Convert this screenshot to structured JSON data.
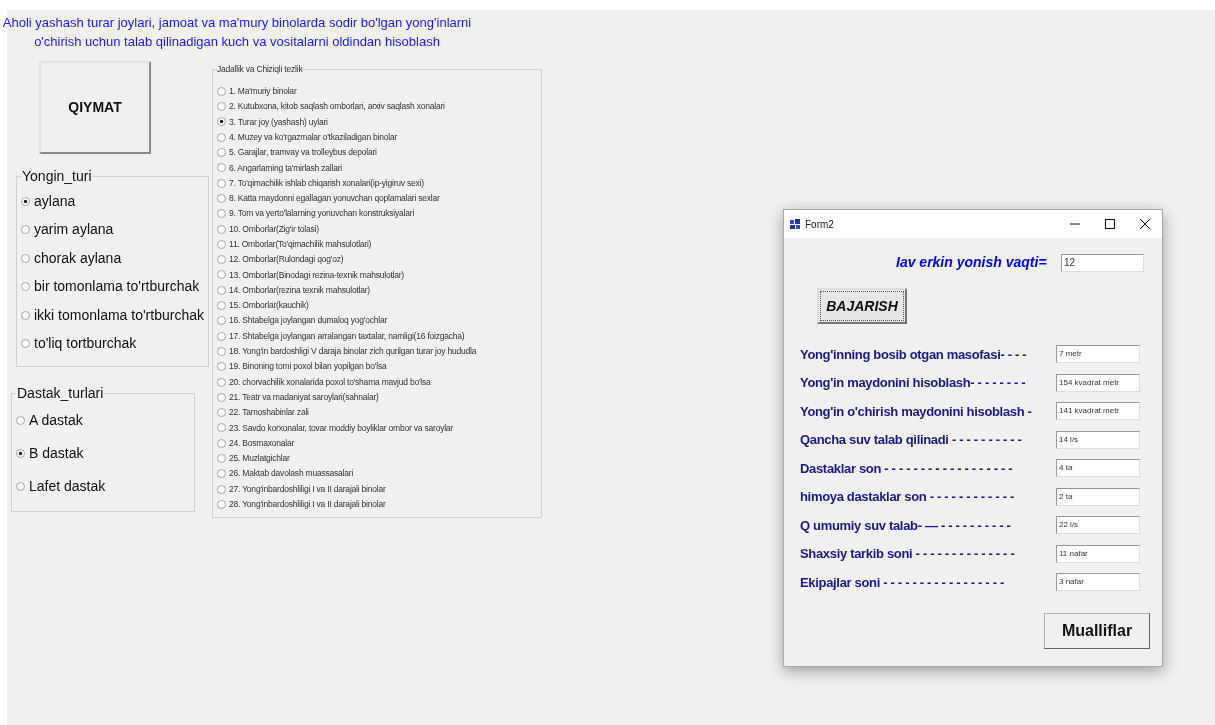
{
  "header": {
    "lines": [
      "Aholi yashash turar joylari, jamoat va ma'mury binolarda sodir bo'lgan yong'inlarni",
      "o'chirish uchun talab qilinadigan kuch va vositalarni oldindan hisoblash"
    ]
  },
  "qiymat_button": "QIYMAT",
  "yongin_turi": {
    "title": "Yongin_turi",
    "options": [
      {
        "label": "aylana",
        "selected": true
      },
      {
        "label": "yarim aylana",
        "selected": false
      },
      {
        "label": "chorak aylana",
        "selected": false
      },
      {
        "label": "bir tomonlama to'rtburchak",
        "selected": false
      },
      {
        "label": "ikki tomonlama to'rtburchak",
        "selected": false
      },
      {
        "label": "to'liq tortburchak",
        "selected": false
      }
    ]
  },
  "dastak_turlari": {
    "title": "Dastak_turlari",
    "options": [
      {
        "label": "A dastak",
        "selected": false
      },
      {
        "label": "B dastak",
        "selected": true
      },
      {
        "label": "Lafet dastak",
        "selected": false
      }
    ]
  },
  "jadallik": {
    "title": "Jadallik va Chiziqli tezlik",
    "options": [
      {
        "label": "1. Ma'muriy binolar",
        "selected": false
      },
      {
        "label": "2. Kutubxona, kitob saqlash omborlari, arxiv saqlash xonalari",
        "selected": false
      },
      {
        "label": "3. Turar joy (yashash) uylari",
        "selected": true
      },
      {
        "label": "4. Muzey va ko'rgazmalar o'tkaziladigan binolar",
        "selected": false
      },
      {
        "label": "5. Garajlar, tramvay va trolleybus depolari",
        "selected": false
      },
      {
        "label": "6. Angarlarning ta'mirlash zallari",
        "selected": false
      },
      {
        "label": "7. To'qimachilik ishlab chiqarish xonalari(ip-yigiruv sexi)",
        "selected": false
      },
      {
        "label": "8. Katta maydonni egallagan yonuvchan qoplamalari sexlar",
        "selected": false
      },
      {
        "label": "9. Tom va yerto'lalarning yonuvchan konstruksiyalari",
        "selected": false
      },
      {
        "label": "10. Omborlar(Zig'ir tolasi)",
        "selected": false
      },
      {
        "label": "11. Omborlar(To'qimachilik mahsulotlari)",
        "selected": false
      },
      {
        "label": "12. Omborlar(Rulondagi qog'oz)",
        "selected": false
      },
      {
        "label": "13. Omborlar(Binodagi rezina-texnik mahsulotlar)",
        "selected": false
      },
      {
        "label": "14. Omborlar(rezina texnik mahsulotlar)",
        "selected": false
      },
      {
        "label": "15. Omborlar(kauchik)",
        "selected": false
      },
      {
        "label": "16. Shtabelga joylangan dumaloq yog'ochlar",
        "selected": false
      },
      {
        "label": "17. Shtabelga joylangan arralangan taxtalar, namligi(16 foizgacha)",
        "selected": false
      },
      {
        "label": "18. Yong'in bardoshligi V daraja binolar zich qurilgan turar joy hududla",
        "selected": false
      },
      {
        "label": "19. Binoning tomi poxol bilan yopilgan bo'lsa",
        "selected": false
      },
      {
        "label": "20. chorvachilik xonalarida poxol to'shama mavjud bo'lsa",
        "selected": false
      },
      {
        "label": "21. Teatr va madaniyat saroylari(sahnalar)",
        "selected": false
      },
      {
        "label": "22. Tamoshabinlar zali",
        "selected": false
      },
      {
        "label": "23. Savdo korxonalar, tovar moddiy boyliklar ombor va saroylar",
        "selected": false
      },
      {
        "label": "24. Bosmaxonalar",
        "selected": false
      },
      {
        "label": "25. Muzlatgichlar",
        "selected": false
      },
      {
        "label": "26. Maktab davolash muassasalari",
        "selected": false
      },
      {
        "label": "27. Yong'inbardoshliligi I va II darajali binolar",
        "selected": false
      },
      {
        "label": "28. Yong'inbardoshliligi I va II darajali binolar",
        "selected": false
      }
    ]
  },
  "form2": {
    "title": "Form2",
    "time_label": "Iav erkin yonish vaqti=",
    "time_value": "12",
    "run_button": "BAJARISH",
    "results": [
      {
        "label": "Yong'inning bosib otgan masofasi- - - -",
        "value": "7 metr"
      },
      {
        "label": "Yong'in maydonini hisoblash- - - - - - - -",
        "value": "154 kvadrat metr"
      },
      {
        "label": "Yong'in o'chirish maydonini hisoblash -",
        "value": "141 kvadrat metr"
      },
      {
        "label": "Qancha suv talab qilinadi - - - - - - - - - -",
        "value": "14 l/s"
      },
      {
        "label": "Dastaklar son - - - - - - - - - - - - - - - - - -",
        "value": "4 ta"
      },
      {
        "label": "himoya dastaklar son - - - - - - - - -  - - -",
        "value": "2 ta"
      },
      {
        "label": "Q umumiy suv talab- — - - - - - - -  - - -",
        "value": "22 l/s"
      },
      {
        "label": "Shaxsiy tarkib soni - - - - - - - - - - - - - -",
        "value": "11 nafar"
      },
      {
        "label": "Ekipajlar soni - - - - - - - - - - - - - - - - -",
        "value": "3 nafar"
      }
    ],
    "authors_button": "Mualliflar"
  }
}
